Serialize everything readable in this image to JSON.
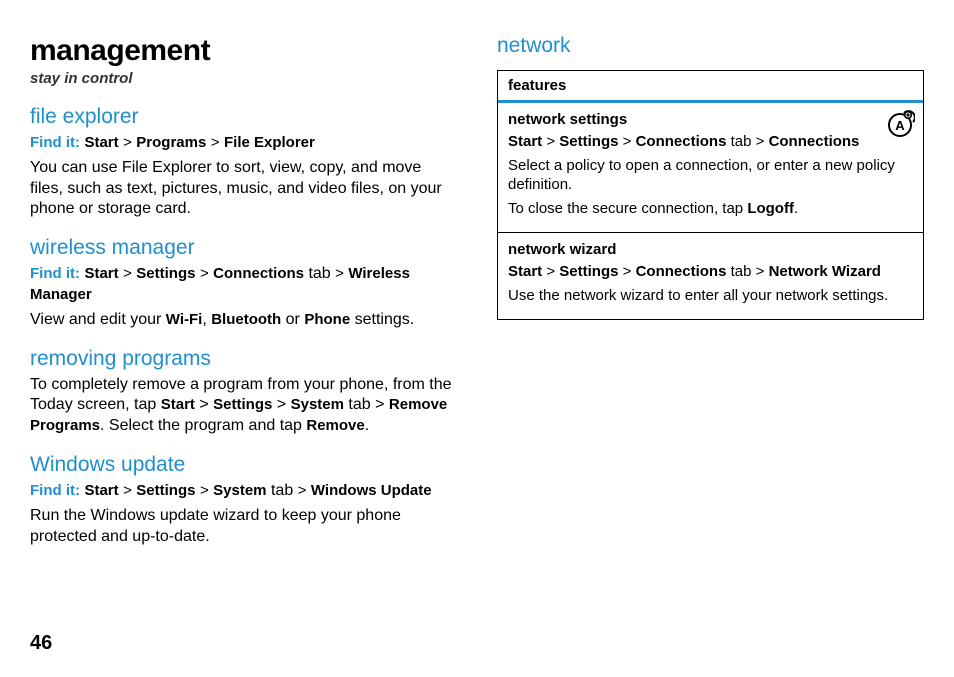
{
  "page_number": "46",
  "left": {
    "title": "management",
    "tagline": "stay in control",
    "sections": {
      "file_explorer": {
        "heading": "file explorer",
        "find_label": "Find it:",
        "path_1": "Start",
        "gt1": ">",
        "path_2": "Programs",
        "gt2": ">",
        "path_3": "File Explorer",
        "body": "You can use File Explorer to sort, view, copy, and move files, such as text, pictures, music, and video files, on your phone or storage card."
      },
      "wireless_manager": {
        "heading": "wireless manager",
        "find_label": "Find it:",
        "p1": "Start",
        "g1": ">",
        "p2": "Settings",
        "g2": ">",
        "p3": "Connections",
        "tab_word": " tab ",
        "g3": ">",
        "p4": "Wireless Manager",
        "body_1": "View and edit your ",
        "wf": "Wi-Fi",
        "comma": ", ",
        "bt": "Bluetooth",
        "or": " or ",
        "ph": "Phone",
        "body_2": " settings."
      },
      "removing_programs": {
        "heading": "removing programs",
        "body_a": "To completely remove a program from your phone, from the Today screen, tap ",
        "p1": "Start",
        "g1": " > ",
        "p2": "Settings",
        "g2": " > ",
        "p3": "System",
        "tab_word": " tab ",
        "g3": "> ",
        "p4": "Remove Programs",
        "body_b": ". Select the program and tap ",
        "p5": "Remove",
        "body_c": "."
      },
      "windows_update": {
        "heading": "Windows update",
        "find_label": "Find it:",
        "p1": "Start",
        "g1": ">",
        "p2": "Settings",
        "g2": ">",
        "p3": "System",
        "tab_word": " tab ",
        "g3": ">",
        "p4": "Windows Update",
        "body": "Run the Windows update wizard to keep your phone protected and up-to-date."
      }
    }
  },
  "right": {
    "heading": "network",
    "features_header": "features",
    "row1": {
      "title": "network settings",
      "p1": "Start",
      "g1": " > ",
      "p2": "Settings",
      "g2": " > ",
      "p3": "Connections",
      "tab_word": " tab ",
      "g3": "> ",
      "p4": "Connections",
      "body_a": "Select a policy to open a connection, or enter a new policy definition.",
      "body_b1": "To close the secure connection, tap ",
      "logoff": "Logoff",
      "body_b2": "."
    },
    "row2": {
      "title": "network wizard",
      "p1": "Start",
      "g1": " > ",
      "p2": "Settings",
      "g2": " > ",
      "p3": "Connections",
      "tab_word": " tab ",
      "g3": "> ",
      "p4": "Network Wizard",
      "body": "Use the network wizard to enter all your network settings."
    }
  }
}
